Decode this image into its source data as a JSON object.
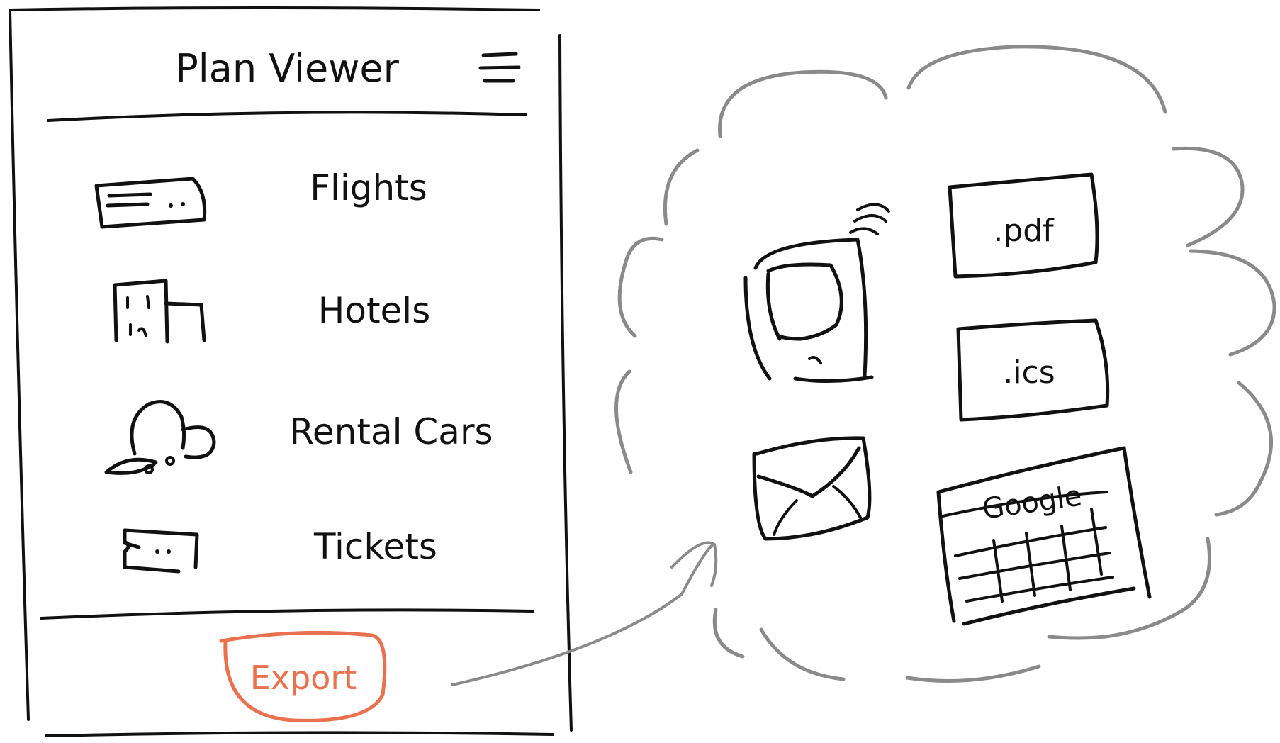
{
  "panel": {
    "title": "Plan Viewer",
    "menu_icon": "hamburger-menu-icon",
    "items": [
      {
        "label": "Flights",
        "icon": "airline-ticket-icon"
      },
      {
        "label": "Hotels",
        "icon": "hotel-building-icon"
      },
      {
        "label": "Rental Cars",
        "icon": "car-icon"
      },
      {
        "label": "Tickets",
        "icon": "ticket-icon"
      }
    ],
    "export_label": "Export"
  },
  "targets": {
    "mobile_icon": "mobile-device-icon",
    "pdf_label": ".pdf",
    "ics_label": ".ics",
    "email_icon": "envelope-icon",
    "google_label": "Google"
  },
  "colors": {
    "ink": "#111111",
    "accent": "#E9714F",
    "cloud": "#8A8A8A"
  }
}
